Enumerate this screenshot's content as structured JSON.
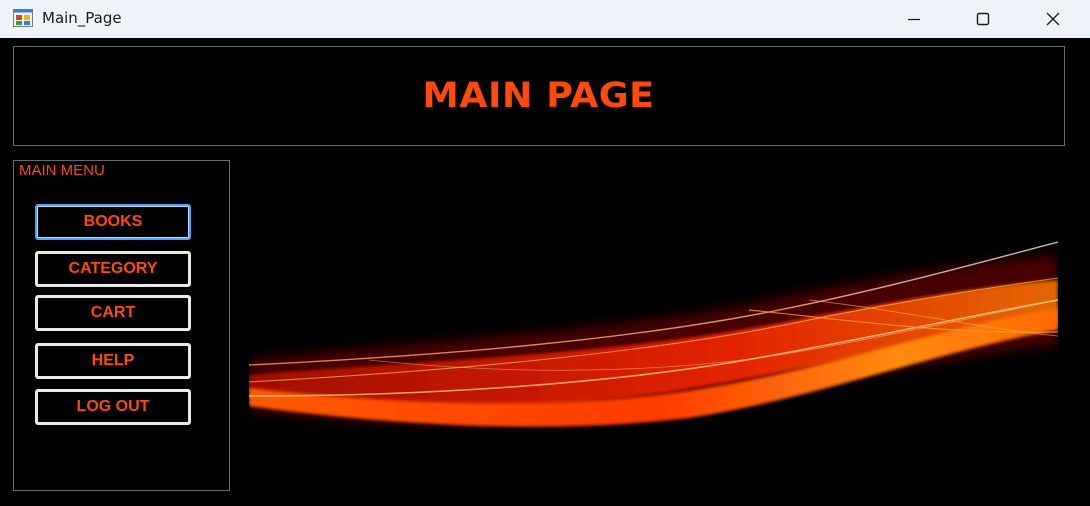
{
  "window": {
    "title": "Main_Page",
    "controls": {
      "minimize": "minimize-icon",
      "maximize": "maximize-icon",
      "close": "close-icon"
    }
  },
  "header": {
    "title": "MAIN PAGE"
  },
  "menu": {
    "legend": "MAIN MENU",
    "items": [
      {
        "label": "BOOKS"
      },
      {
        "label": "CATEGORY"
      },
      {
        "label": "CART"
      },
      {
        "label": "HELP"
      },
      {
        "label": "LOG OUT"
      }
    ]
  },
  "colors": {
    "accent": "#ff4a0b",
    "background": "#000000",
    "titlebar": "#eef2f9",
    "focus_border": "#4aa3ff"
  },
  "banner": {
    "icon": "fire-wave-image"
  }
}
